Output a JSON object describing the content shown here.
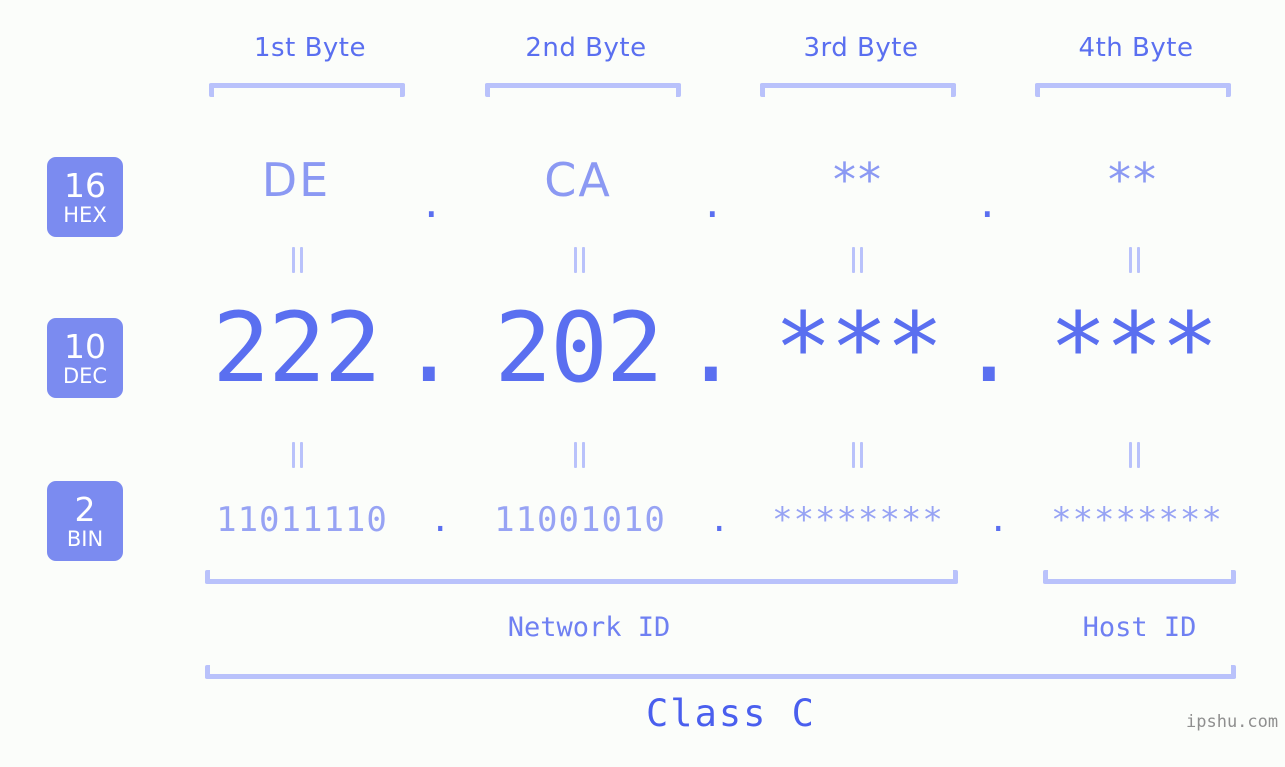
{
  "background_color": "#fbfdfa",
  "accent_color": "#5a6ff0",
  "accent_light_color": "#b9c2fb",
  "badge_color": "#7b8bf0",
  "byte_headers": [
    {
      "label": "1st Byte"
    },
    {
      "label": "2nd Byte"
    },
    {
      "label": "3rd Byte"
    },
    {
      "label": "4th Byte"
    }
  ],
  "bases": [
    {
      "number": "16",
      "name": "HEX"
    },
    {
      "number": "10",
      "name": "DEC"
    },
    {
      "number": "2",
      "name": "BIN"
    }
  ],
  "rows": {
    "hex": {
      "base_number": "16",
      "base_name": "HEX",
      "values": [
        "DE",
        "CA",
        "**",
        "**"
      ],
      "separators": [
        ".",
        ".",
        "."
      ]
    },
    "dec": {
      "base_number": "10",
      "base_name": "DEC",
      "values": [
        "222",
        "202",
        "***",
        "***"
      ],
      "separators": [
        ".",
        ".",
        "."
      ]
    },
    "bin": {
      "base_number": "2",
      "base_name": "BIN",
      "values": [
        "11011110",
        "11001010",
        "********",
        "********"
      ],
      "separators": [
        ".",
        ".",
        "."
      ]
    }
  },
  "equality_separators": {
    "symbol": "||",
    "count_per_row_gap": 4
  },
  "segments": {
    "network_id": "Network ID",
    "host_id": "Host ID"
  },
  "class_label": "Class C",
  "watermark": "ipshu.com"
}
